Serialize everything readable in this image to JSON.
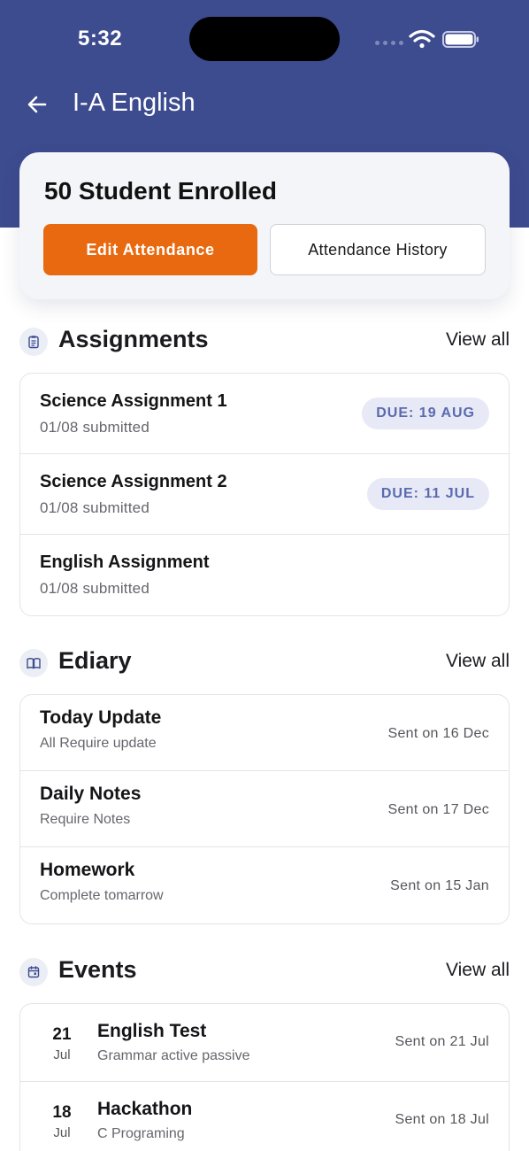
{
  "status_bar": {
    "time": "5:32"
  },
  "header": {
    "title": "I-A English"
  },
  "enrollment": {
    "title": "50 Student Enrolled",
    "edit_label": "Edit Attendance",
    "history_label": "Attendance History"
  },
  "assignments": {
    "title": "Assignments",
    "view_all": "View all",
    "items": [
      {
        "title": "Science Assignment 1",
        "submitted": "01/08 submitted",
        "due": "DUE: 19 AUG"
      },
      {
        "title": "Science Assignment 2",
        "submitted": "01/08 submitted",
        "due": "DUE: 11 JUL"
      },
      {
        "title": "English Assignment",
        "submitted": "01/08 submitted"
      }
    ]
  },
  "ediary": {
    "title": "Ediary",
    "view_all": "View all",
    "items": [
      {
        "title": "Today Update",
        "subtitle": "All Require update",
        "sent": "Sent on 16 Dec"
      },
      {
        "title": "Daily Notes",
        "subtitle": "Require Notes",
        "sent": "Sent on 17 Dec"
      },
      {
        "title": "Homework",
        "subtitle": "Complete tomarrow",
        "sent": "Sent on 15 Jan"
      }
    ]
  },
  "events": {
    "title": "Events",
    "view_all": "View all",
    "items": [
      {
        "day": "21",
        "month": "Jul",
        "title": "English Test",
        "subtitle": "Grammar active passive",
        "sent": "Sent on 21 Jul"
      },
      {
        "day": "18",
        "month": "Jul",
        "title": "Hackathon",
        "subtitle": "C Programing",
        "sent": "Sent on 18 Jul"
      }
    ]
  },
  "colors": {
    "header": "#3d4b8f",
    "accent": "#e8690f",
    "badge_bg": "#e7e9f6",
    "badge_text": "#5a6aaf"
  },
  "icons": {
    "assignments": "clipboard-icon",
    "ediary": "book-icon",
    "events": "calendar-icon",
    "back": "arrow-left-icon"
  }
}
